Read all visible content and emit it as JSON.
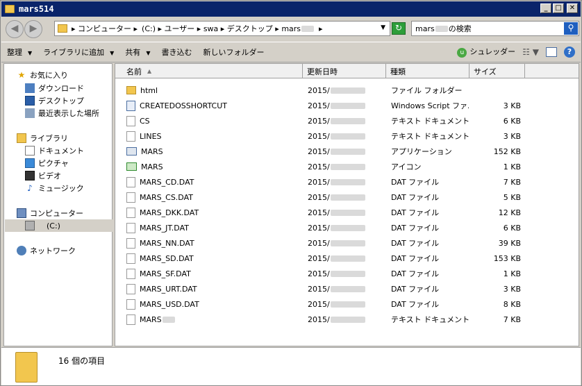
{
  "window": {
    "title": "mars514"
  },
  "address": {
    "crumbs": [
      "▸ コンピューター ▸",
      "(C:) ▸ ユーザー ▸ swa ▸ デスクトップ ▸ mars",
      "▸"
    ],
    "dropdown": "▼"
  },
  "search": {
    "prefix": "mars",
    "suffix": "の検索",
    "icon": "search-icon"
  },
  "toolbar": {
    "organize": "整理",
    "add_to_library": "ライブラリに追加",
    "share": "共有",
    "burn": "書き込む",
    "new_folder": "新しいフォルダー",
    "shredder": "シュレッダー"
  },
  "nav": {
    "favorites": "お気に入り",
    "downloads": "ダウンロード",
    "desktop": "デスクトップ",
    "recent": "最近表示した場所",
    "libraries": "ライブラリ",
    "documents": "ドキュメント",
    "pictures": "ピクチャ",
    "videos": "ビデオ",
    "music": "ミュージック",
    "computer": "コンピューター",
    "drive_c": "(C:)",
    "network": "ネットワーク"
  },
  "columns": {
    "name": "名前",
    "date": "更新日時",
    "type": "種類",
    "size": "サイズ"
  },
  "files": [
    {
      "name": "html",
      "date": "2015/",
      "type": "ファイル フォルダー",
      "size": "",
      "icon": "folder"
    },
    {
      "name": "CREATEDOSSHORTCUT",
      "date": "2015/",
      "type": "Windows Script ファ...",
      "size": "3 KB",
      "icon": "script"
    },
    {
      "name": "CS",
      "date": "2015/",
      "type": "テキスト ドキュメント",
      "size": "6 KB",
      "icon": "txt"
    },
    {
      "name": "LINES",
      "date": "2015/",
      "type": "テキスト ドキュメント",
      "size": "3 KB",
      "icon": "txt"
    },
    {
      "name": "MARS",
      "date": "2015/",
      "type": "アプリケーション",
      "size": "152 KB",
      "icon": "app"
    },
    {
      "name": "MARS",
      "date": "2015/",
      "type": "アイコン",
      "size": "1 KB",
      "icon": "ico"
    },
    {
      "name": "MARS_CD.DAT",
      "date": "2015/",
      "type": "DAT ファイル",
      "size": "7 KB",
      "icon": "blank"
    },
    {
      "name": "MARS_CS.DAT",
      "date": "2015/",
      "type": "DAT ファイル",
      "size": "5 KB",
      "icon": "blank"
    },
    {
      "name": "MARS_DKK.DAT",
      "date": "2015/",
      "type": "DAT ファイル",
      "size": "12 KB",
      "icon": "blank"
    },
    {
      "name": "MARS_JT.DAT",
      "date": "2015/",
      "type": "DAT ファイル",
      "size": "6 KB",
      "icon": "blank"
    },
    {
      "name": "MARS_NN.DAT",
      "date": "2015/",
      "type": "DAT ファイル",
      "size": "39 KB",
      "icon": "blank"
    },
    {
      "name": "MARS_SD.DAT",
      "date": "2015/",
      "type": "DAT ファイル",
      "size": "153 KB",
      "icon": "blank"
    },
    {
      "name": "MARS_SF.DAT",
      "date": "2015/",
      "type": "DAT ファイル",
      "size": "1 KB",
      "icon": "blank"
    },
    {
      "name": "MARS_URT.DAT",
      "date": "2015/",
      "type": "DAT ファイル",
      "size": "3 KB",
      "icon": "blank"
    },
    {
      "name": "MARS_USD.DAT",
      "date": "2015/",
      "type": "DAT ファイル",
      "size": "8 KB",
      "icon": "blank"
    },
    {
      "name": "MARS",
      "date": "2015/",
      "type": "テキスト ドキュメント",
      "size": "7 KB",
      "icon": "txt"
    }
  ],
  "status": {
    "item_count": "16 個の項目"
  }
}
